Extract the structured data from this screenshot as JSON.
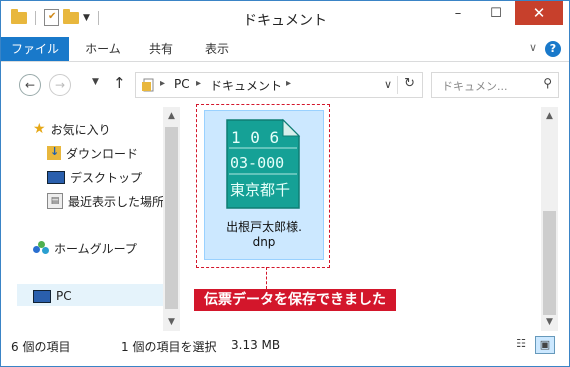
{
  "window": {
    "title": "ドキュメント",
    "controls": {
      "minimize": "–",
      "maximize": "☐",
      "close": "✕"
    }
  },
  "ribbon": {
    "tabs": [
      "ファイル",
      "ホーム",
      "共有",
      "表示"
    ],
    "expand_glyph": "∨",
    "help_glyph": "?"
  },
  "nav": {
    "back_glyph": "←",
    "forward_glyph": "→",
    "up_glyph": "↑",
    "breadcrumb": [
      "PC",
      "ドキュメント"
    ],
    "search_placeholder": "ドキュメン...",
    "accent": "#1979ca"
  },
  "sidebar": {
    "favorites": "お気に入り",
    "items": [
      "ダウンロード",
      "デスクトップ",
      "最近表示した場所"
    ],
    "homegroup": "ホームグループ",
    "pc": "PC"
  },
  "file": {
    "name_line1": "出根戸太郎様.",
    "name_line2": "dnp",
    "icon_lines": [
      "1 0 6",
      "03-000",
      "東京都千"
    ]
  },
  "callout": {
    "text": "伝票データを保存できました",
    "color": "#d3162b"
  },
  "status": {
    "item_count": "6 個の項目",
    "selected": "1 個の項目を選択",
    "size": "3.13 MB"
  }
}
